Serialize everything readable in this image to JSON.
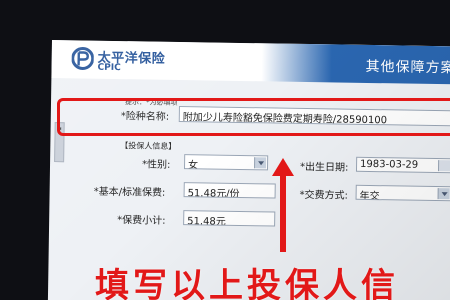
{
  "header": {
    "brand_cn": "太平洋保险",
    "brand_en": "CPIC",
    "page_title": "其他保障方案"
  },
  "form": {
    "hint": "提示：*为必填项",
    "product_label": "*险种名称:",
    "product_value": "附加少儿寿险豁免保险费定期寿险/28590100",
    "section_title": "【投保人信息】",
    "gender_label": "*性别:",
    "gender_value": "女",
    "birth_label": "*出生日期:",
    "birth_value": "1983-03-29",
    "premium_label": "*基本/标准保费:",
    "premium_value": "51.48元/份",
    "payment_label": "*交费方式:",
    "payment_value": "年交",
    "subtotal_label": "*保费小计:",
    "subtotal_value": "51.48元"
  },
  "annotation": {
    "instruction": "填写以上投保人信"
  },
  "colors": {
    "brand_blue": "#2a66b0",
    "annotation_red": "#e21818"
  }
}
